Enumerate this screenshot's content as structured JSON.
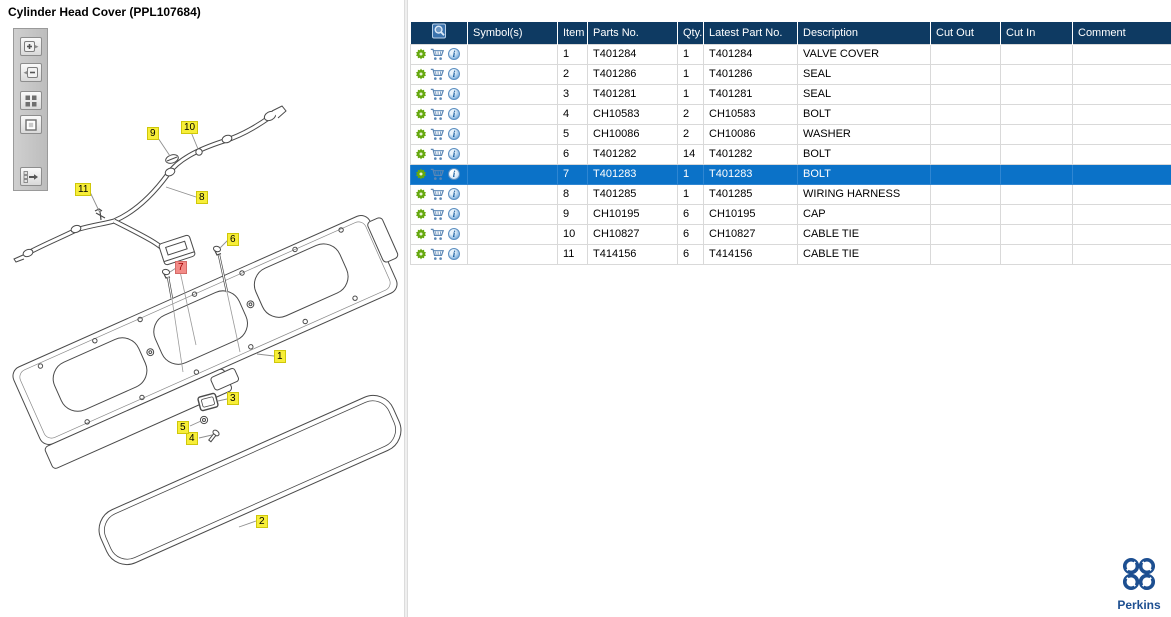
{
  "title": "Cylinder Head Cover (PPL107684)",
  "left_toolbar": {
    "buttons": [
      {
        "icon": "zoom-in-icon"
      },
      {
        "icon": "zoom-out-icon"
      },
      {
        "icon": "zoom-window-icon"
      },
      {
        "icon": "zoom-original-icon"
      },
      {
        "icon": "toggle-parts-list-icon"
      }
    ]
  },
  "diagram": {
    "callouts": [
      {
        "label": "1",
        "highlighted": false
      },
      {
        "label": "2",
        "highlighted": false
      },
      {
        "label": "3",
        "highlighted": false
      },
      {
        "label": "4",
        "highlighted": false
      },
      {
        "label": "5",
        "highlighted": false
      },
      {
        "label": "6",
        "highlighted": false
      },
      {
        "label": "7",
        "highlighted": true
      },
      {
        "label": "8",
        "highlighted": false
      },
      {
        "label": "9",
        "highlighted": false
      },
      {
        "label": "10",
        "highlighted": false
      },
      {
        "label": "11",
        "highlighted": false
      }
    ]
  },
  "table": {
    "header_icon": "page-search-icon",
    "row_icons": [
      "gear-icon",
      "cart-icon",
      "info-icon"
    ],
    "columns": [
      "",
      "Symbol(s)",
      "Item",
      "Parts No.",
      "Qty.",
      "Latest Part No.",
      "Description",
      "Cut Out",
      "Cut In",
      "Comment"
    ],
    "info_glyph": "i",
    "rows": [
      {
        "symbols": "",
        "item": "1",
        "parts_no": "T401284",
        "qty": "1",
        "latest": "T401284",
        "description": "VALVE COVER",
        "cut_out": "",
        "cut_in": "",
        "comment": "",
        "selected": false
      },
      {
        "symbols": "",
        "item": "2",
        "parts_no": "T401286",
        "qty": "1",
        "latest": "T401286",
        "description": "SEAL",
        "cut_out": "",
        "cut_in": "",
        "comment": "",
        "selected": false
      },
      {
        "symbols": "",
        "item": "3",
        "parts_no": "T401281",
        "qty": "1",
        "latest": "T401281",
        "description": "SEAL",
        "cut_out": "",
        "cut_in": "",
        "comment": "",
        "selected": false
      },
      {
        "symbols": "",
        "item": "4",
        "parts_no": "CH10583",
        "qty": "2",
        "latest": "CH10583",
        "description": "BOLT",
        "cut_out": "",
        "cut_in": "",
        "comment": "",
        "selected": false
      },
      {
        "symbols": "",
        "item": "5",
        "parts_no": "CH10086",
        "qty": "2",
        "latest": "CH10086",
        "description": "WASHER",
        "cut_out": "",
        "cut_in": "",
        "comment": "",
        "selected": false
      },
      {
        "symbols": "",
        "item": "6",
        "parts_no": "T401282",
        "qty": "14",
        "latest": "T401282",
        "description": "BOLT",
        "cut_out": "",
        "cut_in": "",
        "comment": "",
        "selected": false
      },
      {
        "symbols": "",
        "item": "7",
        "parts_no": "T401283",
        "qty": "1",
        "latest": "T401283",
        "description": "BOLT",
        "cut_out": "",
        "cut_in": "",
        "comment": "",
        "selected": true
      },
      {
        "symbols": "",
        "item": "8",
        "parts_no": "T401285",
        "qty": "1",
        "latest": "T401285",
        "description": "WIRING HARNESS",
        "cut_out": "",
        "cut_in": "",
        "comment": "",
        "selected": false
      },
      {
        "symbols": "",
        "item": "9",
        "parts_no": "CH10195",
        "qty": "6",
        "latest": "CH10195",
        "description": "CAP",
        "cut_out": "",
        "cut_in": "",
        "comment": "",
        "selected": false
      },
      {
        "symbols": "",
        "item": "10",
        "parts_no": "CH10827",
        "qty": "6",
        "latest": "CH10827",
        "description": "CABLE TIE",
        "cut_out": "",
        "cut_in": "",
        "comment": "",
        "selected": false
      },
      {
        "symbols": "",
        "item": "11",
        "parts_no": "T414156",
        "qty": "6",
        "latest": "T414156",
        "description": "CABLE TIE",
        "cut_out": "",
        "cut_in": "",
        "comment": "",
        "selected": false
      }
    ]
  },
  "branding": {
    "name": "Perkins"
  },
  "colors": {
    "header_bg": "#0e3a62",
    "selected_row_bg": "#0b72c8",
    "callout_bg": "#f7ee38",
    "callout_selected_bg": "#f28b87",
    "callout_selected_text": "#a40000",
    "gear_green": "#66a80f",
    "cart_blue": "#5b87b5",
    "brand_blue": "#1d4f91"
  }
}
